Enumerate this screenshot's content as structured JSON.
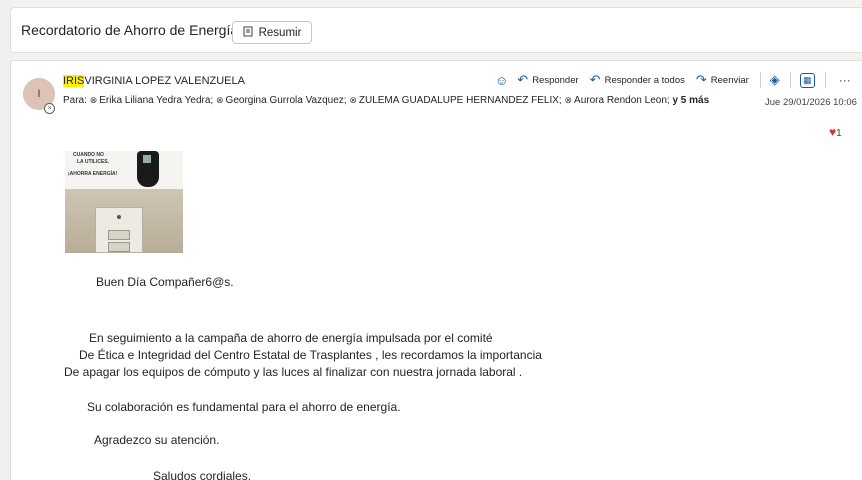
{
  "subject": {
    "title": "Recordatorio de Ahorro de Energía",
    "summarize_label": "Resumir"
  },
  "message": {
    "avatar_initial": "I",
    "sender_highlight": "IRIS",
    "sender_rest": "VIRGINIA LOPEZ VALENZUELA",
    "to_label": "Para:",
    "recipients": [
      "Erika Liliana Yedra Yedra;",
      "Georgina Gurrola Vazquez;",
      "ZULEMA GUADALUPE HERNANDEZ FELIX;",
      "Aurora Rendon Leon;"
    ],
    "more_recipients": "y 5 más",
    "date": "Jue 29/01/2026 10:06",
    "reaction_count": "1",
    "actions": {
      "reply": "Responder",
      "reply_all": "Responder a todos",
      "forward": "Reenviar"
    },
    "image_text": {
      "line1": "CUANDO NO",
      "line2": "LA UTILICES.",
      "line3": "¡AHORRA ENERGÍA!"
    },
    "body": {
      "greeting": "Buen Día   Compañer6@s.",
      "p1_l1": "En seguimiento a la campaña de ahorro de energía impulsada por el comité",
      "p1_l2": "De Ética e Integridad del Centro Estatal de Trasplantes , les recordamos la importancia",
      "p1_l3": "De apagar los equipos de cómputo y las luces al finalizar con nuestra jornada laboral .",
      "p2": "Su colaboración es fundamental para el ahorro de energía.",
      "p3": "Agradezco su atención.",
      "closing": "Saludos cordiales."
    }
  },
  "colors": {
    "accent": "#115ea3",
    "highlight": "#fff200",
    "reaction": "#d13438"
  }
}
